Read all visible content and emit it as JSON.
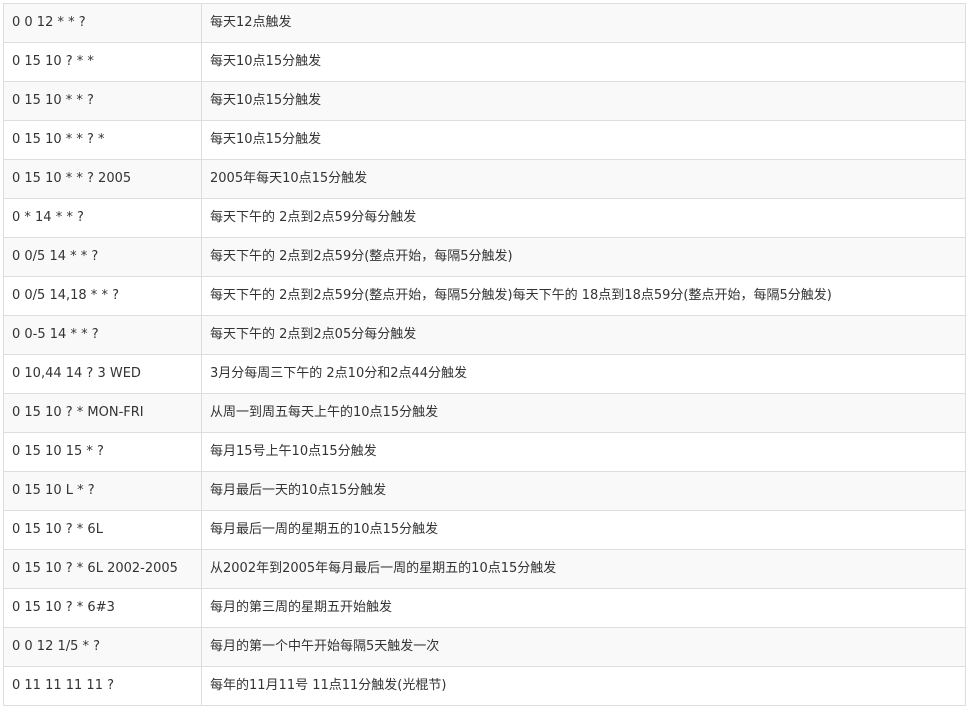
{
  "table": {
    "rows": [
      {
        "expression": "0 0 12 * * ?",
        "description": "每天12点触发"
      },
      {
        "expression": "0 15 10 ? * *",
        "description": "每天10点15分触发"
      },
      {
        "expression": "0 15 10 * * ?",
        "description": "每天10点15分触发"
      },
      {
        "expression": "0 15 10 * * ? *",
        "description": "每天10点15分触发"
      },
      {
        "expression": "0 15 10 * * ? 2005",
        "description": "2005年每天10点15分触发"
      },
      {
        "expression": "0 * 14 * * ?",
        "description": "每天下午的 2点到2点59分每分触发"
      },
      {
        "expression": "0 0/5 14 * * ?",
        "description": "每天下午的 2点到2点59分(整点开始，每隔5分触发)"
      },
      {
        "expression": "0 0/5 14,18 * * ?",
        "description": "每天下午的 2点到2点59分(整点开始，每隔5分触发)每天下午的 18点到18点59分(整点开始，每隔5分触发)"
      },
      {
        "expression": "0 0-5 14 * * ?",
        "description": "每天下午的 2点到2点05分每分触发"
      },
      {
        "expression": "0 10,44 14 ? 3 WED",
        "description": "3月分每周三下午的 2点10分和2点44分触发"
      },
      {
        "expression": "0 15 10 ? * MON-FRI",
        "description": "从周一到周五每天上午的10点15分触发"
      },
      {
        "expression": "0 15 10 15 * ?",
        "description": "每月15号上午10点15分触发"
      },
      {
        "expression": "0 15 10 L * ?",
        "description": "每月最后一天的10点15分触发"
      },
      {
        "expression": "0 15 10 ? * 6L",
        "description": "每月最后一周的星期五的10点15分触发"
      },
      {
        "expression": "0 15 10 ? * 6L 2002-2005",
        "description": "从2002年到2005年每月最后一周的星期五的10点15分触发"
      },
      {
        "expression": "0 15 10 ? * 6#3",
        "description": "每月的第三周的星期五开始触发"
      },
      {
        "expression": "0 0 12 1/5 * ?",
        "description": "每月的第一个中午开始每隔5天触发一次"
      },
      {
        "expression": "0 11 11 11 11 ?",
        "description": "每年的11月11号 11点11分触发(光棍节)"
      }
    ]
  }
}
